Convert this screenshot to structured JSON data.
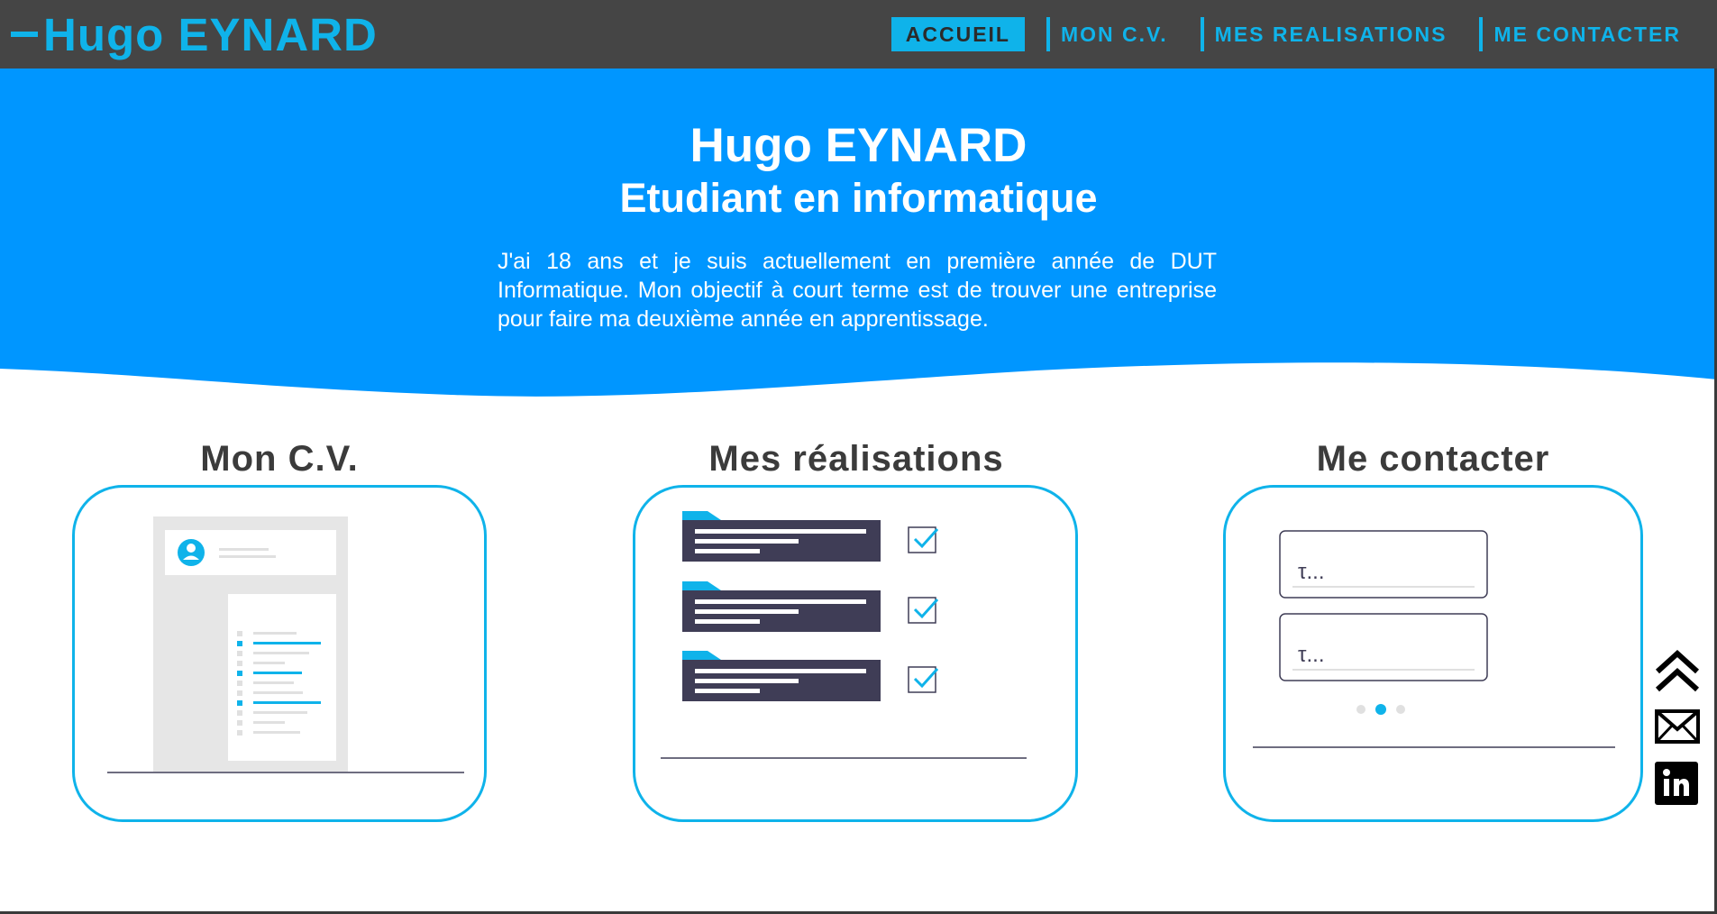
{
  "header": {
    "logo_text": "Hugo EYNARD",
    "nav": [
      {
        "label": "ACCUEIL",
        "active": true
      },
      {
        "label": "MON C.V.",
        "active": false
      },
      {
        "label": "MES REALISATIONS",
        "active": false
      },
      {
        "label": "ME CONTACTER",
        "active": false
      }
    ]
  },
  "hero": {
    "name": "Hugo EYNARD",
    "subtitle": "Etudiant en informatique",
    "text": "J'ai 18 ans et je suis actuellement en première année de DUT Informatique. Mon objectif à court terme est de trouver une entreprise pour faire ma deuxième année en apprentissage."
  },
  "cards": [
    {
      "title": "Mon C.V."
    },
    {
      "title": "Mes réalisations"
    },
    {
      "title": "Me contacter"
    }
  ],
  "contact_illustration": {
    "field_text_1": "τ...",
    "field_text_2": "τ..."
  },
  "side_icons": [
    "chevrons-up-icon",
    "mail-icon",
    "linkedin-icon"
  ],
  "colors": {
    "accent": "#0fb3ea",
    "hero_bg": "#0096ff",
    "topbar_bg": "#454545",
    "dark_illustration": "#3f3d56"
  }
}
